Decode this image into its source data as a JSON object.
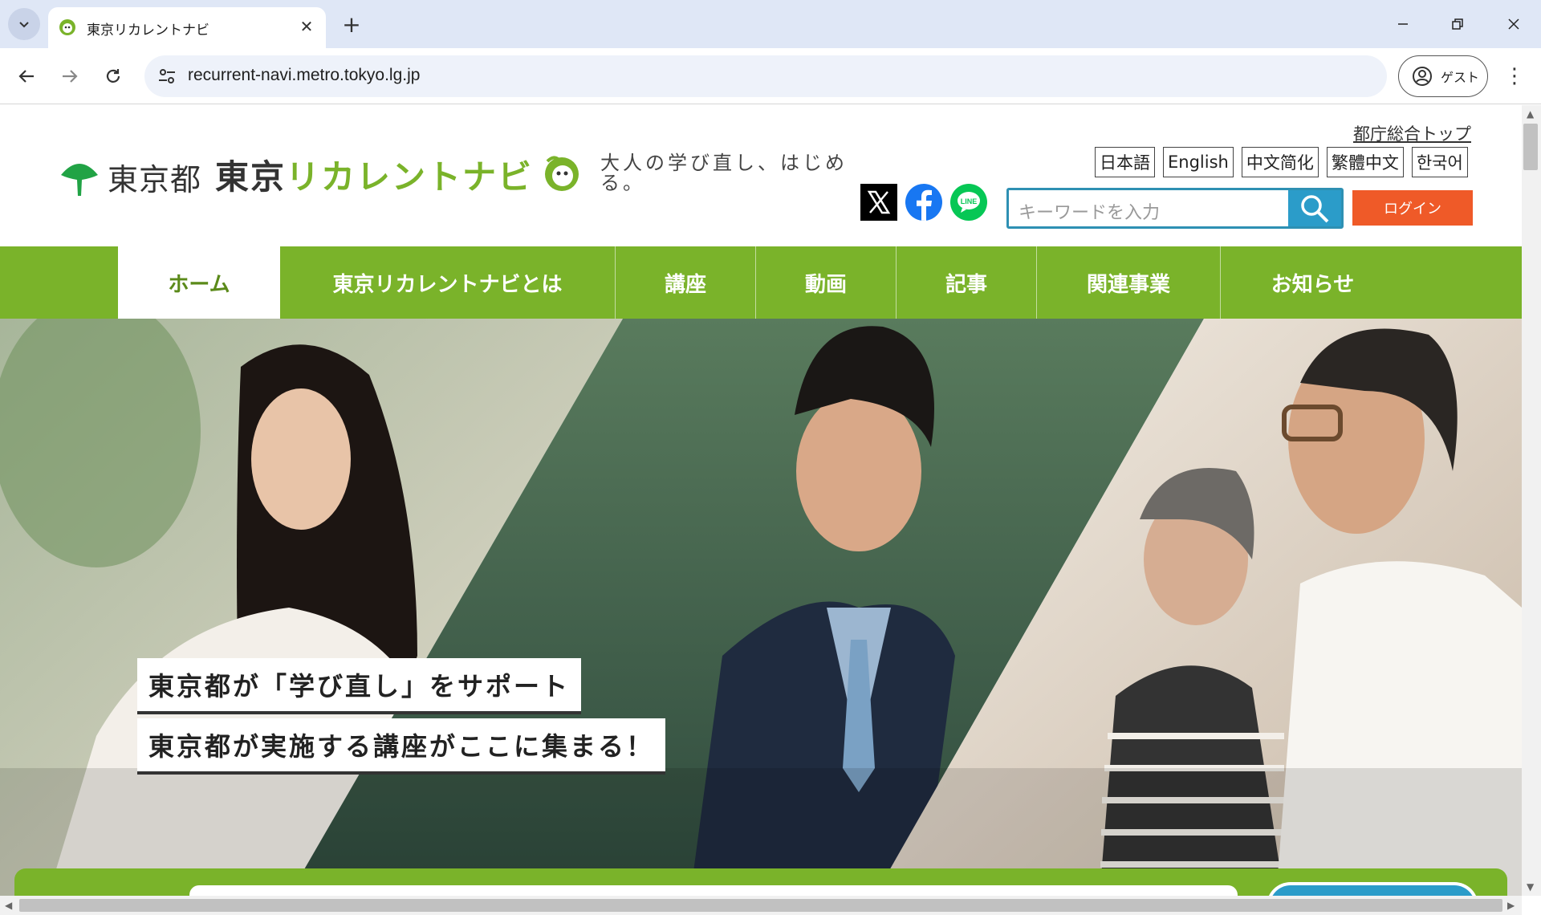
{
  "browser": {
    "tab_title": "東京リカレントナビ",
    "url": "recurrent-navi.metro.tokyo.lg.jp",
    "profile_label": "ゲスト"
  },
  "header": {
    "metro_name": "東京都",
    "site_name_black": "東京",
    "site_name_green": "リカレントナビ",
    "tagline": "大人の学び直し、はじめる。",
    "govtop_link": "都庁総合トップ",
    "languages": [
      "日本語",
      "English",
      "中文简化",
      "繁體中文",
      "한국어"
    ],
    "search_placeholder": "キーワードを入力",
    "login_label": "ログイン",
    "sns": [
      "x-icon",
      "facebook-icon",
      "line-icon"
    ]
  },
  "nav": {
    "items": [
      "ホーム",
      "東京リカレントナビとは",
      "講座",
      "動画",
      "記事",
      "関連事業",
      "お知らせ"
    ],
    "active_index": 0
  },
  "hero": {
    "caption1": "東京都が「学び直し」をサポート",
    "caption2": "東京都が実施する講座がここに集まる！"
  },
  "colors": {
    "brand_green": "#7ab32a",
    "search_blue": "#2b9cc9",
    "login_orange": "#ef5a28"
  }
}
